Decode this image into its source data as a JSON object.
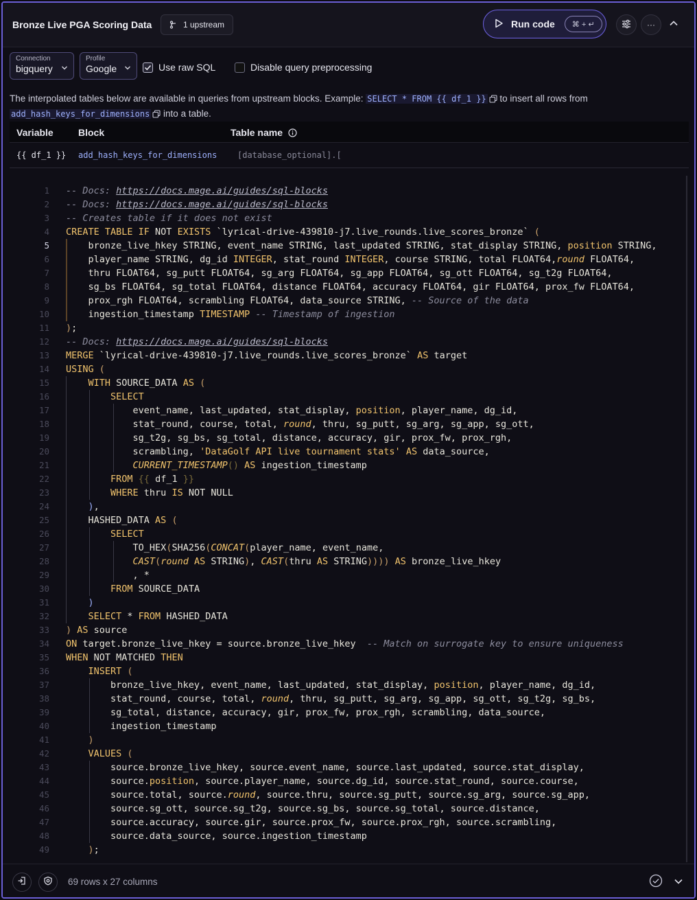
{
  "header": {
    "title": "Bronze Live PGA Scoring Data",
    "upstream_label": "1 upstream",
    "run_label": "Run code",
    "run_shortcut": "⌘ + ↵",
    "more_label": "···"
  },
  "toolbar": {
    "connection_caption": "Connection",
    "connection_value": "bigquery",
    "profile_caption": "Profile",
    "profile_value": "Google",
    "raw_sql_label": "Use raw SQL",
    "raw_sql_checked": true,
    "disable_preproc_label": "Disable query preprocessing",
    "disable_preproc_checked": false
  },
  "info": {
    "prefix": "The interpolated tables below are available in queries from upstream blocks. Example: ",
    "example": "SELECT * FROM {{ df_1 }}",
    "middle": " to insert all rows from",
    "block": "add_hash_keys_for_dimensions",
    "suffix": " into a table."
  },
  "table": {
    "headers": [
      "Variable",
      "Block",
      "Table name"
    ],
    "row": {
      "variable": "{{ df_1 }}",
      "block": "add_hash_keys_for_dimensions",
      "table_name": "[database_optional].["
    }
  },
  "code": {
    "current_line": 5,
    "lines": [
      [
        [
          "cm",
          "-- Docs: "
        ],
        [
          "lk",
          "https://docs.mage.ai/guides/sql-blocks"
        ]
      ],
      [
        [
          "cm",
          "-- Docs: "
        ],
        [
          "lk",
          "https://docs.mage.ai/guides/sql-blocks"
        ]
      ],
      [
        [
          "cm",
          "-- Creates table if it does not exist"
        ]
      ],
      [
        [
          "kw",
          "CREATE TABLE IF "
        ],
        [
          "nm",
          "NOT "
        ],
        [
          "kw",
          "EXISTS "
        ],
        [
          "st",
          "`lyrical-drive-439810-j7.live_rounds.live_scores_bronze` "
        ],
        [
          "pu",
          "("
        ]
      ],
      [
        [
          "nm",
          "    bronze_live_hkey STRING, event_name STRING, last_updated STRING, stat_display STRING, "
        ],
        [
          "kw",
          "position"
        ],
        [
          "nm",
          " STRING,"
        ]
      ],
      [
        [
          "nm",
          "    player_name STRING, dg_id "
        ],
        [
          "kw",
          "INTEGER"
        ],
        [
          "nm",
          ", stat_round "
        ],
        [
          "kw",
          "INTEGER"
        ],
        [
          "nm",
          ", course STRING, total FLOAT64,"
        ],
        [
          "fn",
          "round"
        ],
        [
          "nm",
          " FLOAT64,"
        ]
      ],
      [
        [
          "nm",
          "    thru FLOAT64, sg_putt FLOAT64, sg_arg FLOAT64, sg_app FLOAT64, sg_ott FLOAT64, sg_t2g FLOAT64,"
        ]
      ],
      [
        [
          "nm",
          "    sg_bs FLOAT64, sg_total FLOAT64, distance FLOAT64, accuracy FLOAT64, gir FLOAT64, prox_fw FLOAT64,"
        ]
      ],
      [
        [
          "nm",
          "    prox_rgh FLOAT64, scrambling FLOAT64, data_source STRING, "
        ],
        [
          "cm",
          "-- Source of the data"
        ]
      ],
      [
        [
          "nm",
          "    ingestion_timestamp "
        ],
        [
          "kw",
          "TIMESTAMP "
        ],
        [
          "cm",
          "-- Timestamp of ingestion"
        ]
      ],
      [
        [
          "pu",
          ")"
        ],
        [
          "nm",
          ";"
        ]
      ],
      [
        [
          "cm",
          "-- Docs: "
        ],
        [
          "lk",
          "https://docs.mage.ai/guides/sql-blocks"
        ]
      ],
      [
        [
          "kw",
          "MERGE "
        ],
        [
          "st",
          "`lyrical-drive-439810-j7.live_rounds.live_scores_bronze` "
        ],
        [
          "kw",
          "AS "
        ],
        [
          "nm",
          "target"
        ]
      ],
      [
        [
          "kw",
          "USING "
        ],
        [
          "pu",
          "("
        ]
      ],
      [
        [
          "kw",
          "    WITH "
        ],
        [
          "nm",
          "SOURCE_DATA "
        ],
        [
          "kw",
          "AS "
        ],
        [
          "pu",
          "("
        ]
      ],
      [
        [
          "kw",
          "        SELECT"
        ]
      ],
      [
        [
          "nm",
          "            event_name, last_updated, stat_display, "
        ],
        [
          "kw",
          "position"
        ],
        [
          "nm",
          ", player_name, dg_id,"
        ]
      ],
      [
        [
          "nm",
          "            stat_round, course, total, "
        ],
        [
          "fn",
          "round"
        ],
        [
          "nm",
          ", thru, sg_putt, sg_arg, sg_app, sg_ott,"
        ]
      ],
      [
        [
          "nm",
          "            sg_t2g, sg_bs, sg_total, distance, accuracy, gir, prox_fw, prox_rgh,"
        ]
      ],
      [
        [
          "nm",
          "            scrambling, "
        ],
        [
          "kw",
          "'DataGolf API live tournament stats' "
        ],
        [
          "kw",
          "AS "
        ],
        [
          "nm",
          "data_source,"
        ]
      ],
      [
        [
          "fn",
          "            CURRENT_TIMESTAMP"
        ],
        [
          "pn",
          "() "
        ],
        [
          "kw",
          "AS "
        ],
        [
          "nm",
          "ingestion_timestamp"
        ]
      ],
      [
        [
          "kw",
          "        FROM "
        ],
        [
          "pn",
          "{{ "
        ],
        [
          "nm",
          "df_1 "
        ],
        [
          "pn",
          "}}"
        ]
      ],
      [
        [
          "kw",
          "        WHERE "
        ],
        [
          "nm",
          "thru "
        ],
        [
          "kw",
          "IS "
        ],
        [
          "nm",
          "NOT NULL"
        ]
      ],
      [
        [
          "blu",
          "    )"
        ],
        [
          "nm",
          ","
        ]
      ],
      [
        [
          "nm",
          "    HASHED_DATA "
        ],
        [
          "kw",
          "AS "
        ],
        [
          "pu",
          "("
        ]
      ],
      [
        [
          "kw",
          "        SELECT"
        ]
      ],
      [
        [
          "nm",
          "            TO_HEX"
        ],
        [
          "pu",
          "("
        ],
        [
          "nm",
          "SHA256"
        ],
        [
          "pu",
          "("
        ],
        [
          "fn",
          "CONCAT"
        ],
        [
          "pu",
          "("
        ],
        [
          "nm",
          "player_name, event_name,"
        ]
      ],
      [
        [
          "fn",
          "            CAST"
        ],
        [
          "pu",
          "("
        ],
        [
          "fn",
          "round "
        ],
        [
          "kw",
          "AS "
        ],
        [
          "nm",
          "STRING"
        ],
        [
          "pu",
          ")"
        ],
        [
          "nm",
          ", "
        ],
        [
          "fn",
          "CAST"
        ],
        [
          "pu",
          "("
        ],
        [
          "nm",
          "thru "
        ],
        [
          "kw",
          "AS "
        ],
        [
          "nm",
          "STRING"
        ],
        [
          "pu",
          ")))) "
        ],
        [
          "kw",
          "AS "
        ],
        [
          "nm",
          "bronze_live_hkey"
        ]
      ],
      [
        [
          "nm",
          "            , *"
        ]
      ],
      [
        [
          "kw",
          "        FROM "
        ],
        [
          "nm",
          "SOURCE_DATA"
        ]
      ],
      [
        [
          "blu",
          "    )"
        ]
      ],
      [
        [
          "kw",
          "    SELECT "
        ],
        [
          "nm",
          "* "
        ],
        [
          "kw",
          "FROM "
        ],
        [
          "nm",
          "HASHED_DATA"
        ]
      ],
      [
        [
          "pu",
          ") "
        ],
        [
          "kw",
          "AS "
        ],
        [
          "nm",
          "source"
        ]
      ],
      [
        [
          "kw",
          "ON "
        ],
        [
          "nm",
          "target.bronze_live_hkey = source.bronze_live_hkey  "
        ],
        [
          "cm",
          "-- Match on surrogate key to ensure uniqueness"
        ]
      ],
      [
        [
          "kw",
          "WHEN "
        ],
        [
          "nm",
          "NOT MATCHED "
        ],
        [
          "kw",
          "THEN"
        ]
      ],
      [
        [
          "kw",
          "    INSERT "
        ],
        [
          "pu",
          "("
        ]
      ],
      [
        [
          "nm",
          "        bronze_live_hkey, event_name, last_updated, stat_display, "
        ],
        [
          "kw",
          "position"
        ],
        [
          "nm",
          ", player_name, dg_id,"
        ]
      ],
      [
        [
          "nm",
          "        stat_round, course, total, "
        ],
        [
          "fn",
          "round"
        ],
        [
          "nm",
          ", thru, sg_putt, sg_arg, sg_app, sg_ott, sg_t2g, sg_bs,"
        ]
      ],
      [
        [
          "nm",
          "        sg_total, distance, accuracy, gir, prox_fw, prox_rgh, scrambling, data_source,"
        ]
      ],
      [
        [
          "nm",
          "        ingestion_timestamp"
        ]
      ],
      [
        [
          "pu",
          "    )"
        ]
      ],
      [
        [
          "kw",
          "    VALUES "
        ],
        [
          "pu",
          "("
        ]
      ],
      [
        [
          "nm",
          "        source.bronze_live_hkey, source.event_name, source.last_updated, source.stat_display,"
        ]
      ],
      [
        [
          "nm",
          "        source."
        ],
        [
          "kw",
          "position"
        ],
        [
          "nm",
          ", source.player_name, source.dg_id, source.stat_round, source.course,"
        ]
      ],
      [
        [
          "nm",
          "        source.total, source."
        ],
        [
          "fn",
          "round"
        ],
        [
          "nm",
          ", source.thru, source.sg_putt, source.sg_arg, source.sg_app,"
        ]
      ],
      [
        [
          "nm",
          "        source.sg_ott, source.sg_t2g, source.sg_bs, source.sg_total, source.distance,"
        ]
      ],
      [
        [
          "nm",
          "        source.accuracy, source.gir, source.prox_fw, source.prox_rgh, source.scrambling,"
        ]
      ],
      [
        [
          "nm",
          "        source.data_source, source.ingestion_timestamp"
        ]
      ],
      [
        [
          "pu",
          "    )"
        ],
        [
          "nm",
          ";"
        ]
      ]
    ]
  },
  "footer": {
    "status": "69 rows x 27 columns"
  },
  "colors": {
    "accent": "#6f63e6",
    "keyword": "#f2c46d",
    "comment": "#8d8d9e",
    "background": "#0f0e16"
  },
  "icons": [
    "upstream-branch-icon",
    "play-icon",
    "settings-sliders-icon",
    "more-icon",
    "chevron-up-icon",
    "chevron-down-icon",
    "checkbox-icon",
    "copy-icon",
    "info-icon",
    "exit-icon",
    "shield-icon",
    "check-circle-icon"
  ]
}
